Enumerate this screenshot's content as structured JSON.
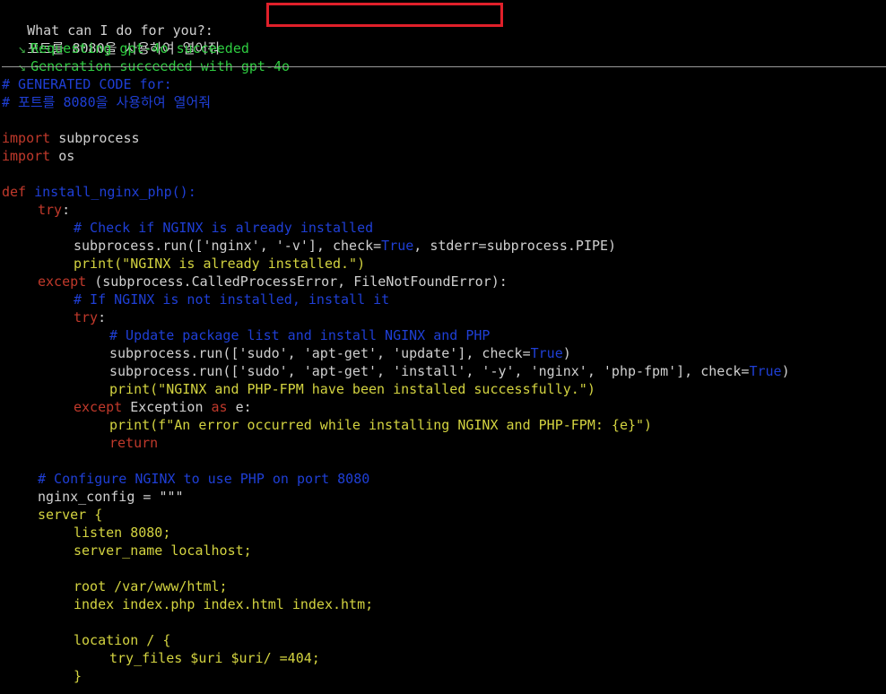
{
  "prompt": {
    "label": "What can I do for you?:",
    "input": "포트를 8080을 사용하여 열어줘"
  },
  "status": [
    {
      "mark": "↘",
      "text": "Requesting gpt-4o succeeded"
    },
    {
      "mark": "↘",
      "text": "Generation succeeded with gpt-4o"
    }
  ],
  "code": {
    "header1": "# GENERATED CODE for:",
    "header2": "# 포트를 8080을 사용하여 열어줘",
    "imp1": "subprocess",
    "imp2": "os",
    "kw_import": "import",
    "kw_def": "def",
    "fn_name": "install_nginx_php():",
    "kw_try": "try",
    "cm1": "# Check if NGINX is already installed",
    "l_run1_a": "subprocess.run(['nginx', '-v'], check=",
    "true": "True",
    "l_run1_b": ", stderr=subprocess.PIPE)",
    "l_print1": "print(\"NGINX is already installed.\")",
    "kw_except": "except",
    "l_except1": " (subprocess.CalledProcessError, FileNotFoundError):",
    "cm2": "# If NGINX is not installed, install it",
    "cm3": "# Update package list and install NGINX and PHP",
    "l_run2": "subprocess.run(['sudo', 'apt-get', 'update'], check=",
    "l_run3": "subprocess.run(['sudo', 'apt-get', 'install', '-y', 'nginx', 'php-fpm'], check=",
    "l_print2": "print(\"NGINX and PHP-FPM have been installed successfully.\")",
    "l_except2_b": " Exception ",
    "kw_as": "as",
    "l_except2_c": " e:",
    "l_print3": "print(f\"An error occurred while installing NGINX and PHP-FPM: {e}\")",
    "kw_return": "return",
    "cm4": "# Configure NGINX to use PHP on port 8080",
    "l_cfg": "nginx_config = \"\"\"",
    "s1": "server {",
    "s2": "listen 8080;",
    "s3": "server_name localhost;",
    "s4": "root /var/www/html;",
    "s5": "index index.php index.html index.htm;",
    "s6": "location / {",
    "s7": "try_files $uri $uri/ =404;",
    "s8": "}"
  }
}
